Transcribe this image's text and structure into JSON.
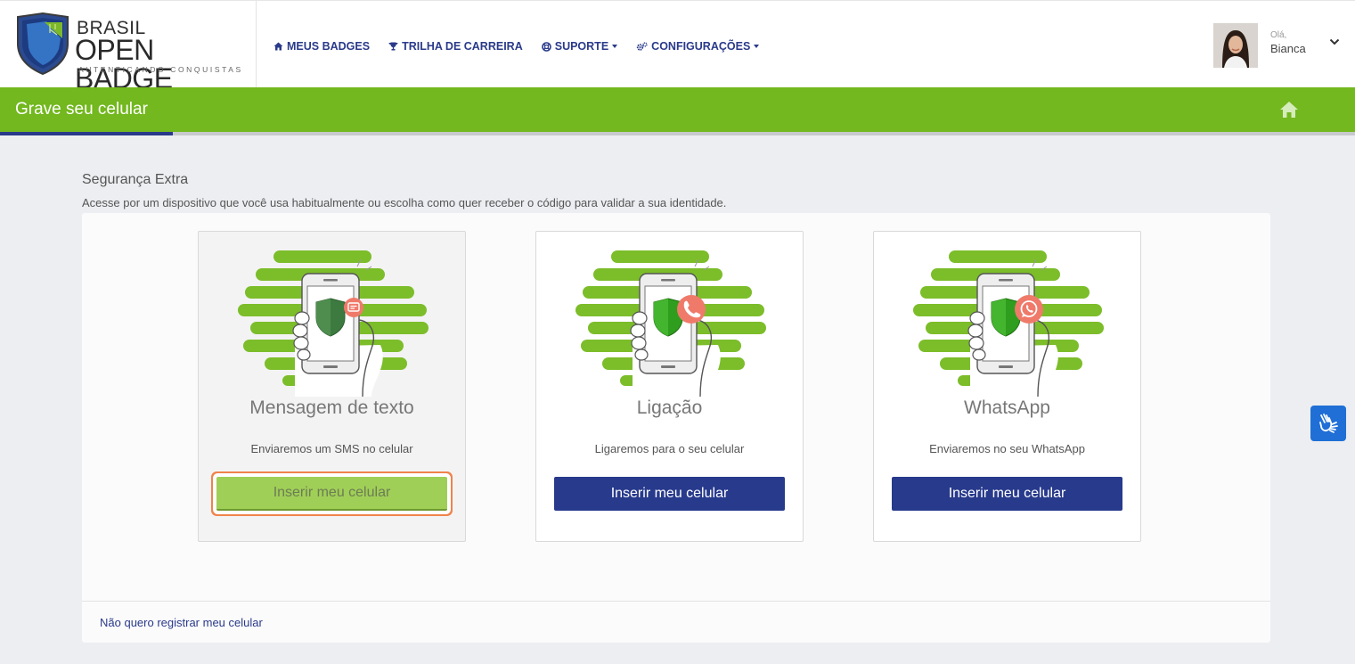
{
  "header": {
    "logo": {
      "line1": "BRASIL",
      "line2": "OPEN BADGE",
      "tagline": "AUTENTICANDO CONQUISTAS"
    },
    "nav": [
      {
        "label": "MEUS BADGES",
        "icon": "home-icon",
        "dropdown": false
      },
      {
        "label": "TRILHA DE CARREIRA",
        "icon": "trophy-icon",
        "dropdown": false
      },
      {
        "label": "SUPORTE",
        "icon": "lifebuoy-icon",
        "dropdown": true
      },
      {
        "label": "CONFIGURAÇÕES",
        "icon": "gears-icon",
        "dropdown": true
      }
    ],
    "user": {
      "greeting": "Olá,",
      "name": "Bianca"
    }
  },
  "page": {
    "title": "Grave seu celular"
  },
  "section": {
    "title": "Segurança Extra",
    "description": "Acesse por um dispositivo que você usa habitualmente ou escolha como quer receber o código para validar a sua identidade."
  },
  "cards": [
    {
      "title": "Mensagem de texto",
      "text": "Enviaremos um SMS no celular",
      "button": "Inserir meu celular",
      "badge_icon": "sms-icon",
      "selected": true
    },
    {
      "title": "Ligação",
      "text": "Ligaremos para o seu celular",
      "button": "Inserir meu celular",
      "badge_icon": "phone-icon",
      "selected": false
    },
    {
      "title": "WhatsApp",
      "text": "Enviaremos no seu WhatsApp",
      "button": "Inserir meu celular",
      "badge_icon": "whatsapp-icon",
      "selected": false
    }
  ],
  "footer": {
    "skip_link": "Não quero registrar meu celular"
  },
  "colors": {
    "brand_green": "#72b81e",
    "brand_blue": "#283a8c",
    "active_button": "#a0cf57",
    "focus_ring": "#f0834a",
    "badge_red": "#ef7a6a",
    "a11y_blue": "#1f6fd6"
  }
}
